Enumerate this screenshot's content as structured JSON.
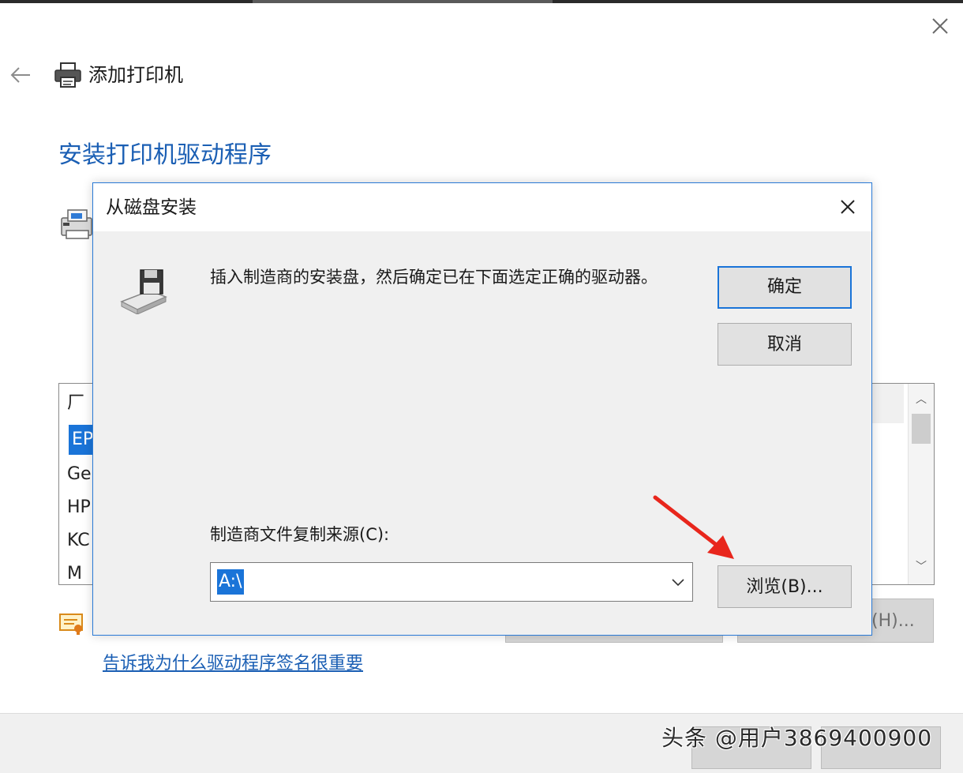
{
  "window": {
    "title": "添加打印机",
    "section_title": "安装打印机驱动程序",
    "close_symbol": "✕",
    "back_symbol": "←"
  },
  "background": {
    "list_rows": [
      "厂",
      "EP",
      "Ge",
      "HP",
      "KC",
      "M"
    ],
    "selected_row_index": 1,
    "button_fragment": "(H)...",
    "signature_link": "告诉我为什么驱动程序签名很重要",
    "footer_watermark": "头条 @用户3869400900"
  },
  "dialog": {
    "title": "从磁盘安装",
    "message": "插入制造商的安装盘，然后确定已在下面选定正确的驱动器。",
    "ok_label": "确定",
    "cancel_label": "取消",
    "source_label": "制造商文件复制来源(C):",
    "source_value": "A:\\",
    "browse_label": "浏览(B)..."
  },
  "colors": {
    "accent": "#1a74d8",
    "title_blue": "#1b5fb4",
    "annotation_arrow": "#e8261c"
  }
}
